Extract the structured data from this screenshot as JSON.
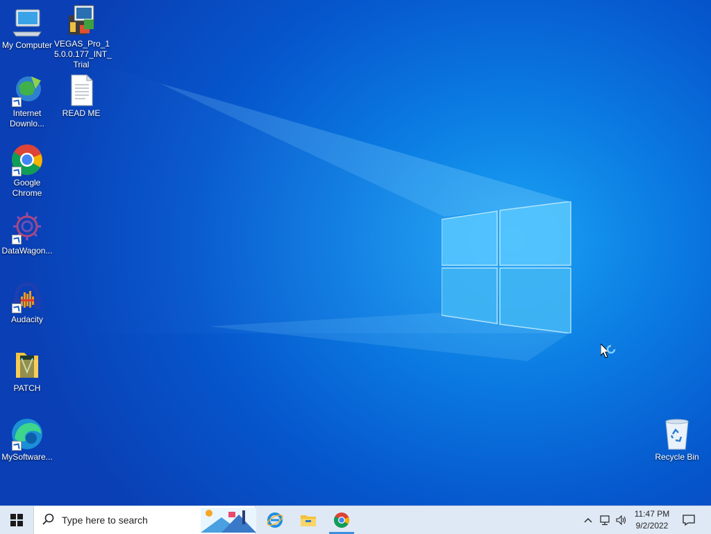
{
  "desktop_icons": [
    {
      "id": "my-computer",
      "label": "My Computer",
      "icon": "computer-icon"
    },
    {
      "id": "vegas",
      "label": "VEGAS_Pro_15.0.0.177_INT_Trial",
      "label_lines": [
        "VEGAS_Pro_1",
        "5.0.0.177_INT_",
        "Trial"
      ],
      "icon": "installer-icon"
    },
    {
      "id": "idm",
      "label_lines": [
        "Internet",
        "Downlo..."
      ],
      "icon": "idm-globe-icon",
      "shortcut": true
    },
    {
      "id": "readme",
      "label": "READ ME",
      "icon": "text-file-icon"
    },
    {
      "id": "chrome",
      "label_lines": [
        "Google",
        "Chrome"
      ],
      "icon": "chrome-icon",
      "shortcut": true
    },
    {
      "id": "datawagon",
      "label": "DataWagon...",
      "icon": "datawagon-gear-icon",
      "shortcut": true
    },
    {
      "id": "audacity",
      "label": "Audacity",
      "icon": "audacity-icon",
      "shortcut": true
    },
    {
      "id": "patch",
      "label": "PATCH",
      "icon": "folder-icon"
    },
    {
      "id": "mysoftware",
      "label": "MySoftware...",
      "icon": "edge-icon",
      "shortcut": true
    },
    {
      "id": "recycle",
      "label": "Recycle Bin",
      "icon": "recycle-bin-icon"
    }
  ],
  "taskbar": {
    "search_placeholder": "Type here to search",
    "pinned": [
      {
        "name": "Internet Explorer",
        "icon": "internet-explorer-icon"
      },
      {
        "name": "File Explorer",
        "icon": "file-explorer-icon"
      },
      {
        "name": "Google Chrome",
        "icon": "chrome-icon",
        "active": true
      }
    ],
    "clock": {
      "time": "11:47 PM",
      "date": "9/2/2022"
    }
  },
  "colors": {
    "accent": "#0a78e0",
    "taskbar": "#dfe9f5"
  }
}
